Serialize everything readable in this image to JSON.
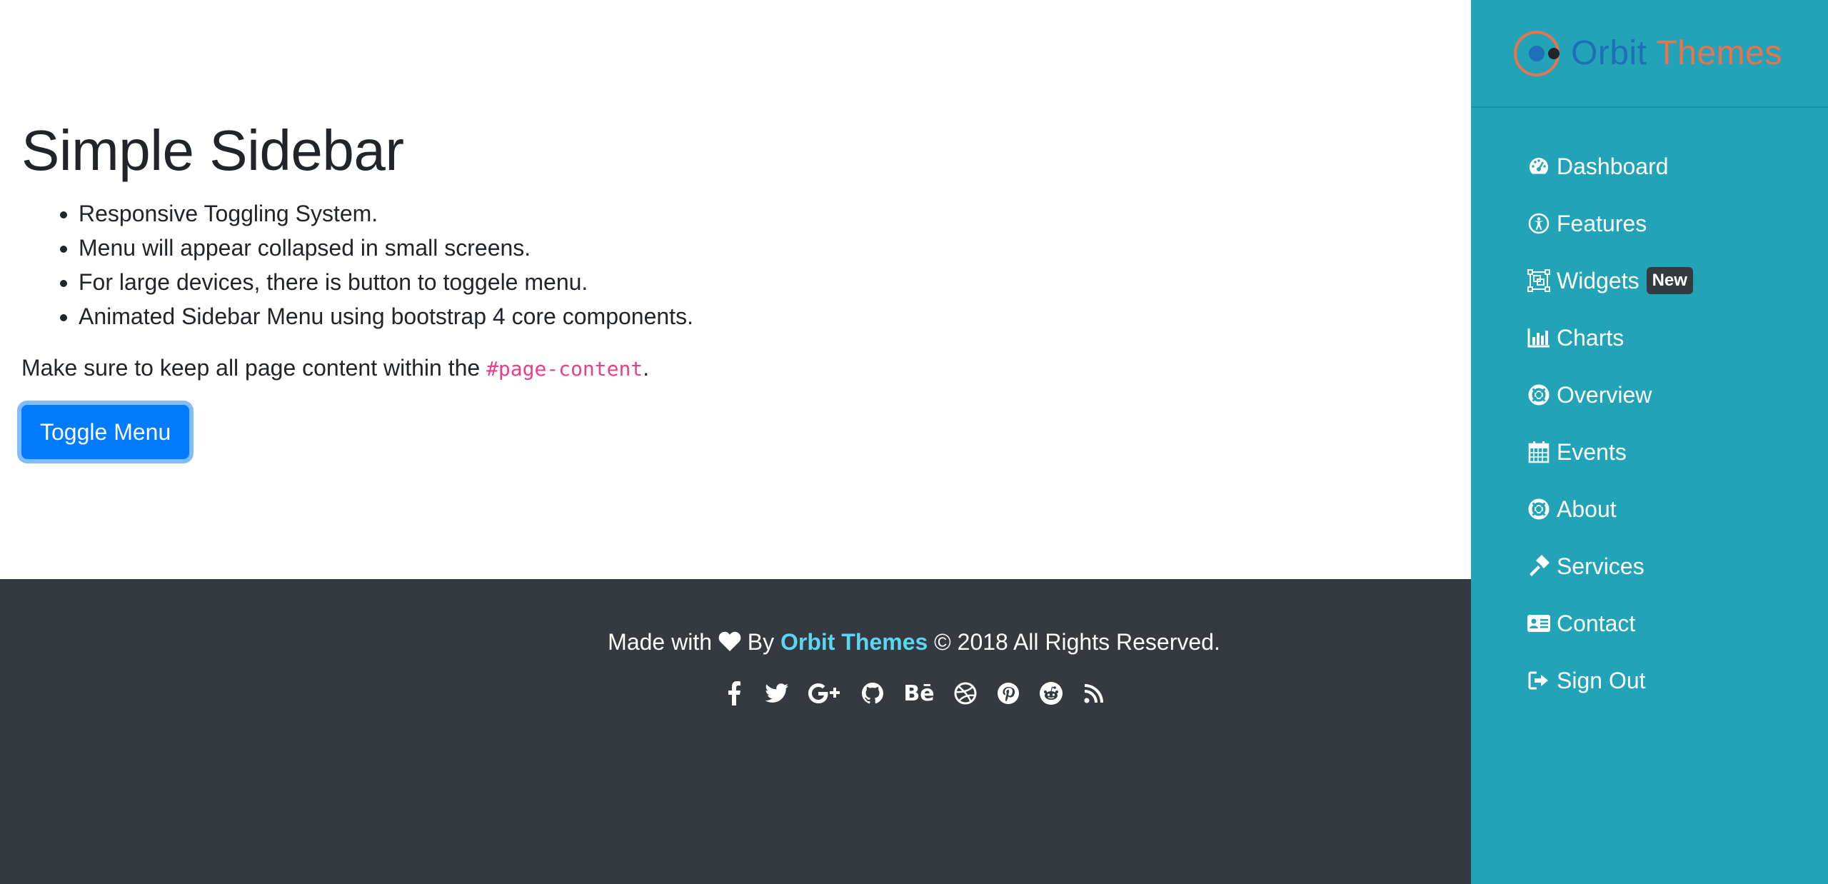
{
  "main": {
    "title": "Simple Sidebar",
    "features": [
      "Responsive Toggling System.",
      "Menu will appear collapsed in small screens.",
      "For large devices, there is button to toggele menu.",
      "Animated Sidebar Menu using bootstrap 4 core components."
    ],
    "note_prefix": "Make sure to keep all page content within the ",
    "note_code": "#page-content",
    "note_suffix": ".",
    "toggle_button": "Toggle Menu"
  },
  "footer": {
    "made_with": "Made with",
    "by": "By",
    "brand": "Orbit Themes",
    "rights": "© 2018 All Rights Reserved.",
    "social": [
      "facebook-icon",
      "twitter-icon",
      "google-plus-icon",
      "github-icon",
      "behance-icon",
      "dribbble-icon",
      "pinterest-icon",
      "reddit-icon",
      "rss-icon"
    ]
  },
  "sidebar": {
    "brand_word1": "Orbit",
    "brand_word2": "Themes",
    "items": [
      {
        "label": "Dashboard",
        "icon": "dashboard-icon"
      },
      {
        "label": "Features",
        "icon": "accessibility-icon"
      },
      {
        "label": "Widgets",
        "icon": "widgets-icon",
        "badge": "New"
      },
      {
        "label": "Charts",
        "icon": "bar-chart-icon"
      },
      {
        "label": "Overview",
        "icon": "life-ring-icon"
      },
      {
        "label": "Events",
        "icon": "calendar-icon"
      },
      {
        "label": "About",
        "icon": "life-ring-icon"
      },
      {
        "label": "Services",
        "icon": "gavel-icon"
      },
      {
        "label": "Contact",
        "icon": "address-card-icon"
      },
      {
        "label": "Sign Out",
        "icon": "sign-out-icon"
      }
    ]
  },
  "colors": {
    "sidebar_bg": "#23a3b8",
    "footer_bg": "#343a40",
    "primary": "#007bff",
    "brand_link": "#5bd6f2",
    "code": "#e83e8c"
  }
}
